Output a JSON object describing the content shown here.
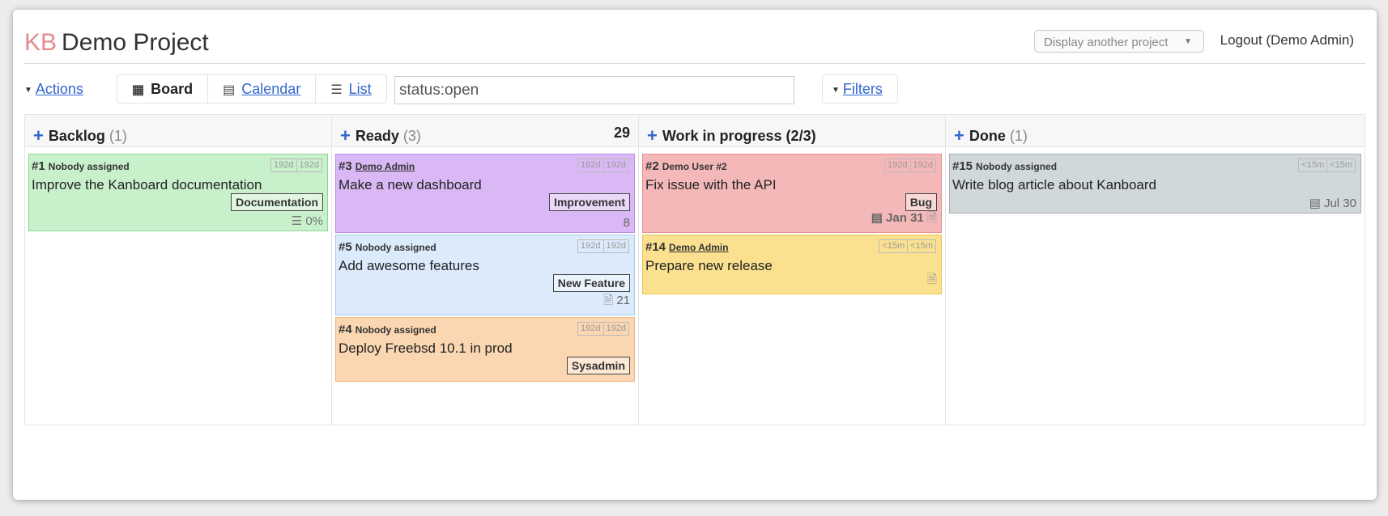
{
  "header": {
    "logo": "KB",
    "project_name": "Demo Project",
    "project_selector": "Display another project",
    "logout_label": "Logout",
    "user_label": "(Demo Admin)"
  },
  "toolbar": {
    "actions_label": "Actions",
    "views": [
      {
        "label": "Board",
        "icon": "grid-icon"
      },
      {
        "label": "Calendar",
        "icon": "calendar-icon"
      },
      {
        "label": "List",
        "icon": "list-icon"
      }
    ],
    "search_value": "status:open",
    "filters_label": "Filters"
  },
  "columns": [
    {
      "title": "Backlog",
      "count": "(1)",
      "limit": "",
      "cards": [
        {
          "id": "#1",
          "assignee": "Nobody assigned",
          "times": [
            "192d",
            "192d"
          ],
          "title": "Improve the Kanboard documentation",
          "category": "Documentation",
          "footer": "0%",
          "color": "green"
        }
      ]
    },
    {
      "title": "Ready",
      "count": "(3)",
      "limit": "29",
      "cards": [
        {
          "id": "#3",
          "assignee": "Demo Admin",
          "times": [
            "192d",
            "192d"
          ],
          "title": "Make a new dashboard",
          "category": "Improvement",
          "footer": "8",
          "color": "purple"
        },
        {
          "id": "#5",
          "assignee": "Nobody assigned",
          "times": [
            "192d",
            "192d"
          ],
          "title": "Add awesome features",
          "category": "New Feature",
          "footer": "21",
          "color": "blue"
        },
        {
          "id": "#4",
          "assignee": "Nobody assigned",
          "times": [
            "192d",
            "192d"
          ],
          "title": "Deploy Freebsd 10.1 in prod",
          "category": "Sysadmin",
          "footer": "",
          "color": "orange"
        }
      ]
    },
    {
      "title": "Work in progress (2/3)",
      "count": "",
      "limit": "",
      "cards": [
        {
          "id": "#2",
          "assignee": "Demo User #2",
          "times": [
            "192d",
            "192d"
          ],
          "title": "Fix issue with the API",
          "category": "Bug",
          "footer": "Jan 31",
          "color": "red"
        },
        {
          "id": "#14",
          "assignee": "Demo Admin",
          "times": [
            "<15m",
            "<15m"
          ],
          "title": "Prepare new release",
          "category": "",
          "footer": "",
          "color": "yellow"
        }
      ]
    },
    {
      "title": "Done",
      "count": "(1)",
      "limit": "",
      "cards": [
        {
          "id": "#15",
          "assignee": "Nobody assigned",
          "times": [
            "<15m",
            "<15m"
          ],
          "title": "Write blog article about Kanboard",
          "category": "",
          "footer": "Jul 30",
          "color": "grey"
        }
      ]
    }
  ],
  "colors": {
    "green": {
      "bg": "#c8f0cb",
      "border": "#8fd694"
    },
    "purple": {
      "bg": "#d9b8f5",
      "border": "#b68fe0"
    },
    "blue": {
      "bg": "#dbebfc",
      "border": "#a8c8ee"
    },
    "orange": {
      "bg": "#fad6b1",
      "border": "#f0b57d"
    },
    "red": {
      "bg": "#f5b8b8",
      "border": "#e58e8e"
    },
    "yellow": {
      "bg": "#fbe18f",
      "border": "#efc54e"
    },
    "grey": {
      "bg": "#d1d8da",
      "border": "#a6b0b3"
    }
  }
}
